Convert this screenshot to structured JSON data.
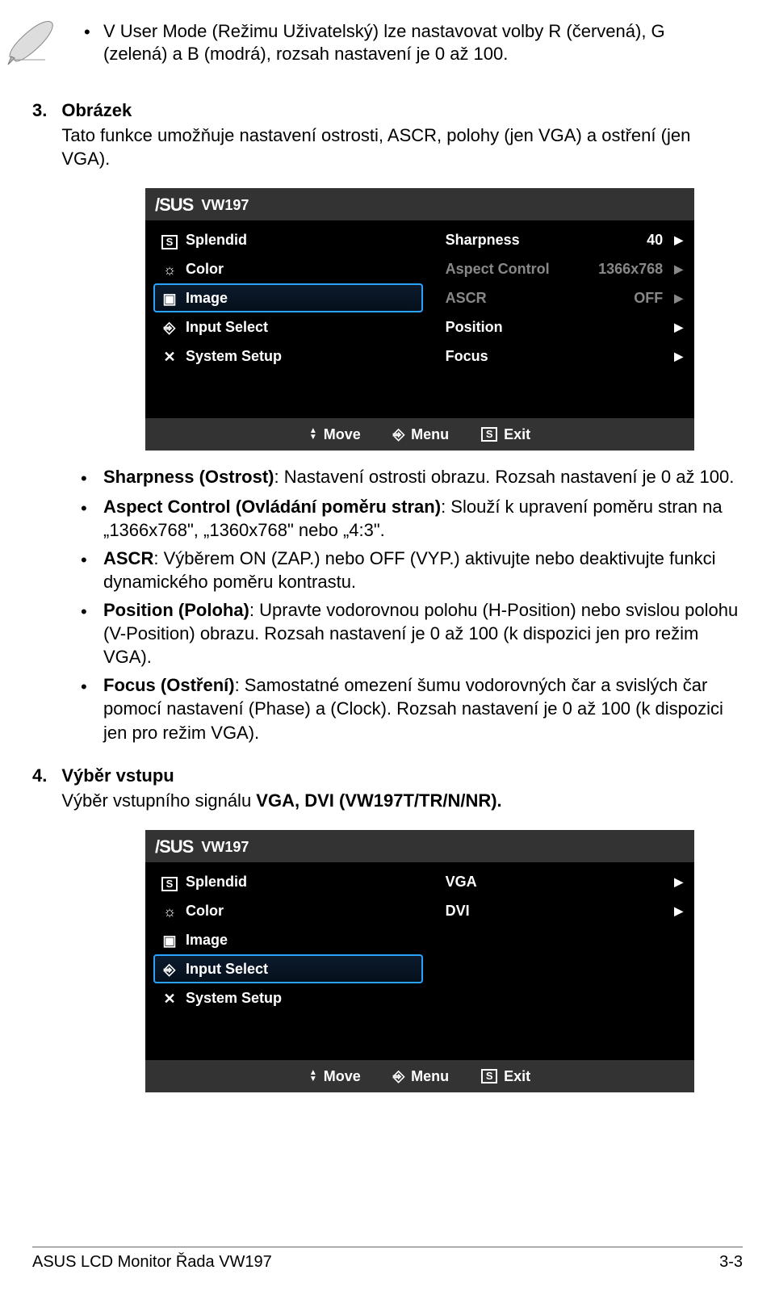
{
  "note": {
    "text": "V User Mode (Režimu Uživatelský) lze nastavovat volby R (červená), G (zelená) a B (modrá), rozsah nastavení je 0 až 100."
  },
  "section3": {
    "num": "3.",
    "title": "Obrázek",
    "body": "Tato funkce umožňuje nastavení ostrosti, ASCR, polohy (jen VGA) a ostření (jen VGA)."
  },
  "osd1": {
    "model": "VW197",
    "left": [
      {
        "label": "Splendid",
        "icon": "S"
      },
      {
        "label": "Color",
        "icon": "☼"
      },
      {
        "label": "Image",
        "icon": "▣",
        "selected": true
      },
      {
        "label": "Input Select",
        "icon": "⎆"
      },
      {
        "label": "System Setup",
        "icon": "✕"
      }
    ],
    "right": [
      {
        "label": "Sharpness",
        "value": "40"
      },
      {
        "label": "Aspect Control",
        "value": "1366x768",
        "dim": true
      },
      {
        "label": "ASCR",
        "value": "OFF",
        "dim": true
      },
      {
        "label": "Position",
        "value": ""
      },
      {
        "label": "Focus",
        "value": ""
      }
    ],
    "footer": {
      "move": "Move",
      "menu": "Menu",
      "exit": "Exit"
    }
  },
  "bullets3": [
    {
      "prefix": "Sharpness (Ostrost)",
      "rest": ": Nastavení ostrosti obrazu. Rozsah nastavení je 0 až 100."
    },
    {
      "prefix": "Aspect Control (Ovládání poměru stran)",
      "rest": ": Slouží k upravení poměru stran na „1366x768\", „1360x768\" nebo „4:3\"."
    },
    {
      "prefix": "ASCR",
      "rest": ": Výběrem ON (ZAP.) nebo OFF (VYP.) aktivujte nebo deaktivujte funkci dynamického poměru kontrastu."
    },
    {
      "prefix": "Position (Poloha)",
      "rest": ": Upravte vodorovnou polohu (H-Position) nebo svislou polohu (V-Position) obrazu. Rozsah nastavení je 0 až 100 (k dispozici jen pro režim VGA)."
    },
    {
      "prefix": "Focus (Ostření)",
      "rest": ": Samostatné omezení šumu vodorovných čar a svislých čar pomocí nastavení (Phase) a (Clock). Rozsah nastavení je 0 až 100 (k dispozici jen pro režim VGA)."
    }
  ],
  "section4": {
    "num": "4.",
    "title": "Výběr vstupu",
    "body_pre": "Výběr vstupního signálu ",
    "body_bold": "VGA, DVI (VW197T/TR/N/NR).",
    "body_post": ""
  },
  "osd2": {
    "model": "VW197",
    "left": [
      {
        "label": "Splendid",
        "icon": "S"
      },
      {
        "label": "Color",
        "icon": "☼"
      },
      {
        "label": "Image",
        "icon": "▣"
      },
      {
        "label": "Input Select",
        "icon": "⎆",
        "selected": true
      },
      {
        "label": "System Setup",
        "icon": "✕"
      }
    ],
    "right": [
      {
        "label": "VGA",
        "value": ""
      },
      {
        "label": "DVI",
        "value": ""
      }
    ],
    "footer": {
      "move": "Move",
      "menu": "Menu",
      "exit": "Exit"
    }
  },
  "footer": {
    "left": "ASUS LCD Monitor Řada VW197",
    "right": "3-3"
  }
}
